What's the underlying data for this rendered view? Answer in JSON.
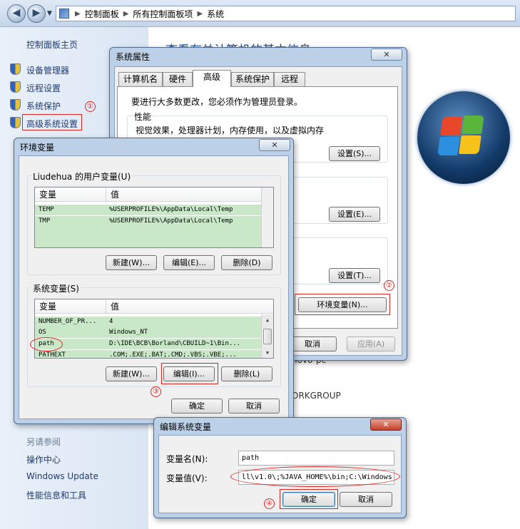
{
  "explorer": {
    "breadcrumbs": [
      "控制面板",
      "所有控制面板项",
      "系统"
    ],
    "sidebar": {
      "home": "控制面板主页",
      "items": [
        "设备管理器",
        "远程设置",
        "系统保护",
        "高级系统设置"
      ],
      "see_also": "另请参阅",
      "see_also_items": [
        "操作中心",
        "Windows Update",
        "性能信息和工具"
      ]
    },
    "main": {
      "heading": "查看有关计算机的基本信息",
      "lines": [
        "novo-pc",
        "ORKGROUP"
      ]
    }
  },
  "sys_props": {
    "title": "系统属性",
    "close": "✕",
    "tabs": [
      "计算机名",
      "硬件",
      "高级",
      "系统保护",
      "远程"
    ],
    "active_tab": "高级",
    "admin_note": "要进行大多数更改，您必须作为管理员登录。",
    "perf_label": "性能",
    "perf_desc": "视觉效果，处理器计划，内存使用，以及虚拟内存",
    "settings_s": "设置(S)...",
    "settings_e": "设置(E)...",
    "settings_t": "设置(T)...",
    "env_button": "环境变量(N)...",
    "cancel": "取消",
    "apply": "应用(A)"
  },
  "env_vars": {
    "title": "环境变量",
    "close": "✕",
    "user_group": "Liudehua 的用户变量(U)",
    "col_var": "变量",
    "col_val": "值",
    "user_rows": [
      {
        "name": "TEMP",
        "value": "%USERPROFILE%\\AppData\\Local\\Temp"
      },
      {
        "name": "TMP",
        "value": "%USERPROFILE%\\AppData\\Local\\Temp"
      }
    ],
    "new_w": "新建(W)...",
    "edit_e": "编辑(E)...",
    "delete_d": "删除(D)",
    "sys_group": "系统变量(S)",
    "sys_rows": [
      {
        "name": "NUMBER_OF_PR...",
        "value": "4"
      },
      {
        "name": "OS",
        "value": "Windows_NT"
      },
      {
        "name": "path",
        "value": "D:\\IDE\\BCB\\Borland\\CBUILD~1\\Bin..."
      },
      {
        "name": "PATHEXT",
        "value": ".COM;.EXE;.BAT;.CMD;.VBS;.VBE;..."
      }
    ],
    "new_w2": "新建(W)...",
    "edit_i": "编辑(I)...",
    "delete_l": "删除(L)",
    "ok": "确定",
    "cancel": "取消"
  },
  "edit_var": {
    "title": "编辑系统变量",
    "close": "✕",
    "name_label": "变量名(N):",
    "name_value": "path",
    "value_label": "变量值(V):",
    "value_value": "ll\\v1.0\\;%JAVA_HOME%\\bin;C:\\Windows",
    "ok": "确定",
    "cancel": "取消"
  },
  "annotations": [
    "①",
    "②",
    "③",
    "④"
  ],
  "colors": {
    "annotation": "#d9261c",
    "selected_row": "#c8e8c8",
    "link": "#1f3b70"
  }
}
